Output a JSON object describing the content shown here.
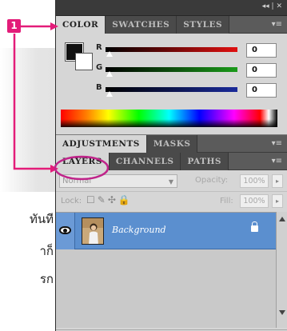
{
  "callout": {
    "number": "1"
  },
  "background_text": [
    "ทันที",
    "าก็",
    "รก"
  ],
  "panel": {
    "controls": "◂◂ | ✕",
    "top_tabs": [
      "COLOR",
      "SWATCHES",
      "STYLES"
    ],
    "color": {
      "foreground": "#111111",
      "background": "#ffffff",
      "sliders": [
        {
          "label": "R",
          "value": "0",
          "color": "#e01010"
        },
        {
          "label": "G",
          "value": "0",
          "color": "#1a9a1a"
        },
        {
          "label": "B",
          "value": "0",
          "color": "#1a2a9a"
        }
      ]
    },
    "mid_tabs": [
      "ADJUSTMENTS",
      "MASKS"
    ],
    "layer_tabs": [
      "LAYERS",
      "CHANNELS",
      "PATHS"
    ],
    "layers": {
      "blend_mode": "Normal",
      "opacity_label": "Opacity:",
      "opacity_value": "100%",
      "lock_label": "Lock:",
      "fill_label": "Fill:",
      "fill_value": "100%",
      "items": [
        {
          "name": "Background",
          "visible": true,
          "locked": true,
          "selected": true
        }
      ]
    }
  },
  "colors": {
    "accent": "#e31c79",
    "selection": "#5b8fcf",
    "panel_dark": "#535353",
    "panel_light": "#d6d6d6"
  }
}
